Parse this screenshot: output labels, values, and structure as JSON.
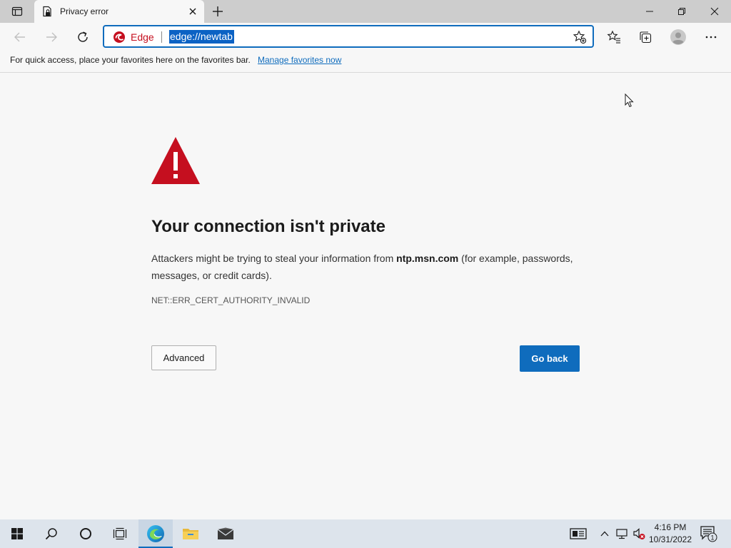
{
  "tab": {
    "title": "Privacy error"
  },
  "address_bar": {
    "brand": "Edge",
    "url": "edge://newtab"
  },
  "favorites_bar": {
    "message": "For quick access, place your favorites here on the favorites bar.",
    "link": "Manage favorites now"
  },
  "error_page": {
    "heading": "Your connection isn't private",
    "description_prefix": "Attackers might be trying to steal your information from ",
    "domain": "ntp.msn.com",
    "description_suffix": " (for example, passwords, messages, or credit cards).",
    "error_code": "NET::ERR_CERT_AUTHORITY_INVALID",
    "advanced_button": "Advanced",
    "go_back_button": "Go back"
  },
  "taskbar": {
    "time": "4:16 PM",
    "date": "10/31/2022",
    "notification_count": "1",
    "pinned_icons": [
      "start-icon",
      "search-icon",
      "cortana-icon",
      "task-view-icon",
      "edge-icon",
      "file-explorer-icon",
      "mail-icon"
    ]
  },
  "colors": {
    "accent": "#0f6cbd",
    "warning": "#c50f1f",
    "url_highlight": "#0b62c4"
  }
}
